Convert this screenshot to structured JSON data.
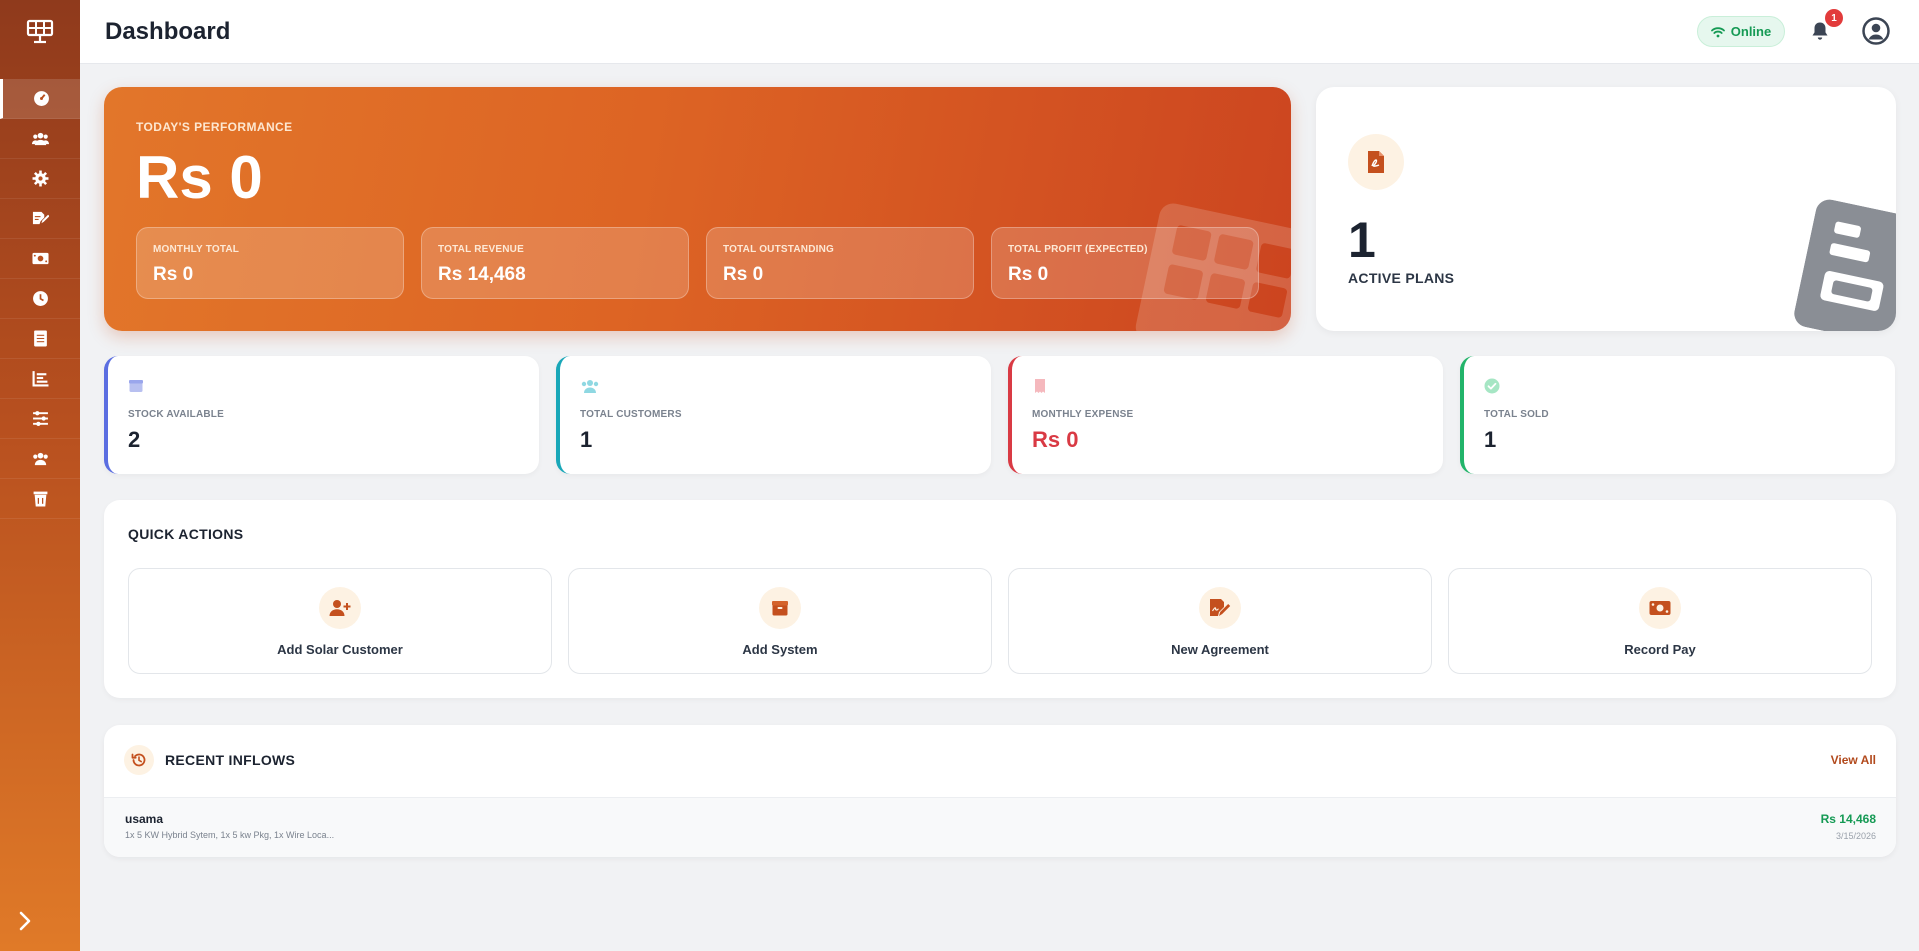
{
  "sidebar": {
    "logo_icon": "solar-panel-icon",
    "items": [
      {
        "icon": "dashboard-icon",
        "active": true
      },
      {
        "icon": "customers-icon"
      },
      {
        "icon": "gear-icon"
      },
      {
        "icon": "agreement-icon"
      },
      {
        "icon": "payment-icon"
      },
      {
        "icon": "clock-icon"
      },
      {
        "icon": "document-icon"
      },
      {
        "icon": "chart-icon"
      },
      {
        "icon": "sliders-icon"
      },
      {
        "icon": "users-icon"
      },
      {
        "icon": "trash-icon"
      }
    ],
    "toggle_icon": "chevron-right-icon"
  },
  "header": {
    "title": "Dashboard",
    "status": "Online",
    "notification_count": "1"
  },
  "hero": {
    "kicker": "TODAY'S PERFORMANCE",
    "amount": "Rs 0",
    "stats": [
      {
        "label": "MONTHLY TOTAL",
        "value": "Rs 0"
      },
      {
        "label": "TOTAL REVENUE",
        "value": "Rs 14,468"
      },
      {
        "label": "TOTAL OUTSTANDING",
        "value": "Rs 0"
      },
      {
        "label": "TOTAL PROFIT (EXPECTED)",
        "value": "Rs 0"
      }
    ]
  },
  "plans": {
    "count": "1",
    "label": "ACTIVE PLANS"
  },
  "stats": [
    {
      "label": "STOCK AVAILABLE",
      "value": "2",
      "color": "#5b6ee1",
      "icon": "box-icon"
    },
    {
      "label": "TOTAL CUSTOMERS",
      "value": "1",
      "color": "#19a7b8",
      "icon": "customers-icon"
    },
    {
      "label": "MONTHLY EXPENSE",
      "value": "Rs 0",
      "color": "#d93a44",
      "icon": "receipt-icon"
    },
    {
      "label": "TOTAL SOLD",
      "value": "1",
      "color": "#22b46a",
      "icon": "check-circle-icon"
    }
  ],
  "quick_actions": {
    "title": "QUICK ACTIONS",
    "items": [
      {
        "label": "Add Solar Customer",
        "icon": "user-plus-icon"
      },
      {
        "label": "Add System",
        "icon": "box-icon"
      },
      {
        "label": "New Agreement",
        "icon": "signature-icon"
      },
      {
        "label": "Record Pay",
        "icon": "money-icon"
      }
    ]
  },
  "recent_inflows": {
    "title": "RECENT INFLOWS",
    "view_all": "View All",
    "rows": [
      {
        "name": "usama",
        "description": "1x 5 KW Hybrid Sytem, 1x 5 kw Pkg, 1x Wire Loca...",
        "amount": "Rs 14,468",
        "date": "3/15/2026"
      }
    ]
  },
  "colors": {
    "accent": "#dd6424",
    "accent_dark": "#b24a1d",
    "success": "#159a54",
    "danger": "#d93a44"
  }
}
